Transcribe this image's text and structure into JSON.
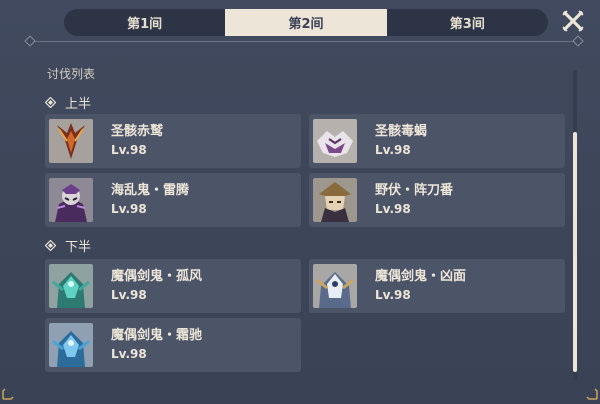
{
  "tabs": [
    {
      "label": "第1间",
      "active": false
    },
    {
      "label": "第2间",
      "active": true
    },
    {
      "label": "第3间",
      "active": false
    }
  ],
  "list_title": "讨伐列表",
  "sections": [
    {
      "label": "上半",
      "enemies": [
        {
          "name": "圣骸赤鹫",
          "level": "Lv.98",
          "icon": "red-vulture-portrait"
        },
        {
          "name": "圣骸毒蝎",
          "level": "Lv.98",
          "icon": "scorpion-portrait"
        },
        {
          "name": "海乱鬼・雷腾",
          "level": "Lv.98",
          "icon": "kairagi-thunder-portrait"
        },
        {
          "name": "野伏・阵刀番",
          "level": "Lv.98",
          "icon": "nobushi-portrait"
        }
      ]
    },
    {
      "label": "下半",
      "enemies": [
        {
          "name": "魔偶剑鬼・孤风",
          "level": "Lv.98",
          "icon": "maguu-kenki-wind-portrait"
        },
        {
          "name": "魔偶剑鬼・凶面",
          "level": "Lv.98",
          "icon": "maguu-kenki-mask-portrait"
        },
        {
          "name": "魔偶剑鬼・霜驰",
          "level": "Lv.98",
          "icon": "maguu-kenki-frost-portrait"
        }
      ]
    }
  ],
  "colors": {
    "background": "#3b4255",
    "card": "#4c5468",
    "accent": "#ece5d8"
  }
}
